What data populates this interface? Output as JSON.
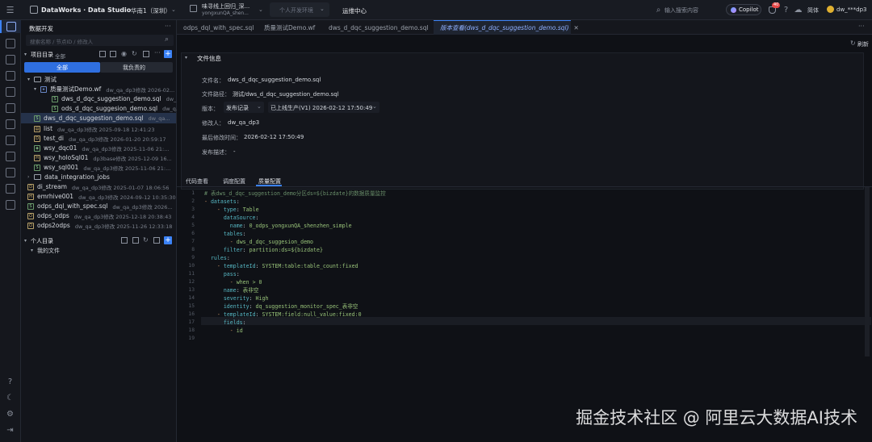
{
  "topbar": {
    "brand": "DataWorks · Data Studio",
    "region": "华南1（深圳）",
    "workspace_line1": "味寻线上回归_深...",
    "workspace_line2": "yongxunQA_shen...",
    "env": "个人开发环境",
    "ops": "运维中心",
    "search_placeholder": "输入搜索内容",
    "copilot": "Copilot",
    "notif_count": "40",
    "lang": "简体",
    "user": "dw_***dp3"
  },
  "sidebar": {
    "title": "数据开发",
    "search_placeholder": "搜索名称 / 节点ID / 修改人",
    "project_label": "项目目录",
    "project_filter": "全部",
    "tab_all": "全部",
    "tab_mine": "我负责的",
    "tree": [
      {
        "name": "测试",
        "type": "folder",
        "meta": ""
      },
      {
        "name": "质量测试Demo.wf",
        "type": "wf",
        "meta": "dw_qa_dp3修改 2026-02..."
      },
      {
        "name": "dws_d_dqc_suggestion_demo.sql",
        "type": "sql",
        "meta": "dw_..."
      },
      {
        "name": "ods_d_dqc_suggesion_demo.sql",
        "type": "sql",
        "meta": "dw_q..."
      },
      {
        "name": "dws_d_dqc_suggestion_demo.sql",
        "type": "sql",
        "meta": "dw_qa..."
      },
      {
        "name": "list",
        "type": "node",
        "meta": "dw_qa_dp3修改 2025-09-18 12:41:23"
      },
      {
        "name": "test_di",
        "type": "node",
        "meta": "dw_qa_dp3修改 2026-01-20 20:59:17"
      },
      {
        "name": "wsy_dqc01",
        "type": "node",
        "meta": "dw_qa_dp3修改 2025-11-06 21:..."
      },
      {
        "name": "wsy_holoSql01",
        "type": "node",
        "meta": "dp3base修改 2025-12-09 16..."
      },
      {
        "name": "wsy_sql001",
        "type": "node",
        "meta": "dw_qa_dp3修改 2025-11-06 21:..."
      },
      {
        "name": "data_integration_jobs",
        "type": "folder",
        "meta": ""
      },
      {
        "name": "di_stream",
        "type": "node",
        "meta": "dw_qa_dp3修改 2025-01-07 18:06:56"
      },
      {
        "name": "emrhive001",
        "type": "node",
        "meta": "dw_qa_dp3修改 2024-09-12 10:35:30"
      },
      {
        "name": "odps_dql_with_spec.sql",
        "type": "node",
        "meta": "dw_qa_dp3修改 2026..."
      },
      {
        "name": "odps_odps",
        "type": "node",
        "meta": "dw_qa_dp3修改 2025-12-18 20:38:43"
      },
      {
        "name": "odps2odps",
        "type": "node",
        "meta": "dw_qa_dp3修改 2025-11-26 12:33:18"
      }
    ],
    "personal_label": "个人目录",
    "my_files": "我的文件"
  },
  "tabs": [
    {
      "label": "odps_dql_with_spec.sql",
      "active": false
    },
    {
      "label": "质量测试Demo.wf",
      "active": false
    },
    {
      "label": "dws_d_dqc_suggestion_demo.sql",
      "active": false
    },
    {
      "label": "版本查看(dws_d_dqc_suggestion_demo.sql)",
      "active": true
    }
  ],
  "file_info": {
    "section_title": "文件信息",
    "refresh": "刷新",
    "name_label": "文件名：",
    "name_value": "dws_d_dqc_suggestion_demo.sql",
    "path_label": "文件路径：",
    "path_value": "测试/dws_d_dqc_suggestion_demo.sql",
    "version_label": "版本：",
    "version_select": "发布记录",
    "version_value": "已上线生产(V1) 2026-02-12 17:50:49",
    "modifier_label": "修改人：",
    "modifier_value": "dw_qa_dp3",
    "modtime_label": "最后修改时间：",
    "modtime_value": "2026-02-12 17:50:49",
    "desc_label": "发布描述：",
    "desc_value": "-"
  },
  "subtabs": [
    "代码查看",
    "调度配置",
    "质量配置"
  ],
  "code_lines": [
    "# 表dws_d_dqc_suggestion_demo分区ds=${bizdate}的数据质量监控",
    "- datasets:",
    "    - type: Table",
    "      dataSource:",
    "        name: 0_odps_yongxunQA_shenzhen_simple",
    "      tables:",
    "        - dws_d_dqc_suggesion_demo",
    "      filter: partition:ds=${bizdate}",
    "  rules:",
    "    - templateId: SYSTEM:table:table_count:fixed",
    "      pass:",
    "        - when > 0",
    "      name: 表非空",
    "      severity: High",
    "      identity: dq_suggestion_monitor_spec_表非空",
    "    - templateId: SYSTEM:field:null_value:fixed:0",
    "      fields:",
    "        - id",
    ""
  ],
  "watermark": "掘金技术社区 @ 阿里云大数据AI技术",
  "colors": {
    "accent": "#3b82f6",
    "bg": "#0f1116",
    "active_tab": "#1e2430"
  }
}
